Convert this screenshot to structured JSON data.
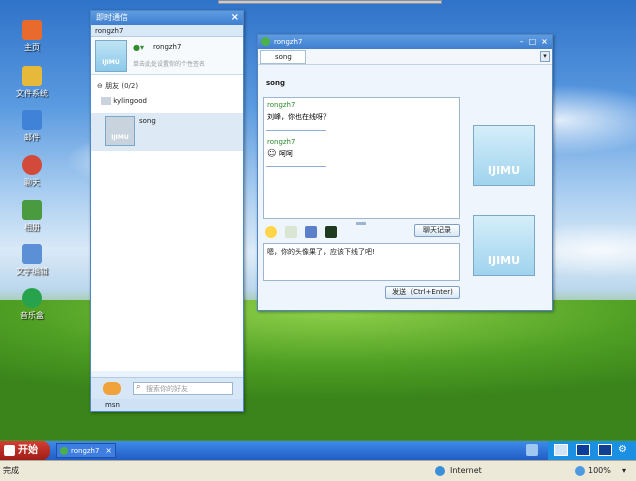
{
  "desktop": {
    "icons": [
      {
        "label": "主页",
        "icon": "home-icon",
        "color": "#e86a2c"
      },
      {
        "label": "文件系统",
        "icon": "folder-icon",
        "color": "#e6b93a"
      },
      {
        "label": "邮件",
        "icon": "mail-icon",
        "color": "#3f82d8"
      },
      {
        "label": "聊天",
        "icon": "chat-icon",
        "color": "#d14a3a"
      },
      {
        "label": "相册",
        "icon": "photo-icon",
        "color": "#4a9a3f"
      },
      {
        "label": "文字编辑",
        "icon": "edit-icon",
        "color": "#5b8fd6"
      },
      {
        "label": "音乐盒",
        "icon": "music-icon",
        "color": "#27a34d"
      }
    ]
  },
  "im_window": {
    "title": "即时通信",
    "account_header": "rongzh7",
    "profile": {
      "name": "rongzh7",
      "signature_placeholder": "单击此处设置你的个性签名",
      "avatar_text": "IJIMU"
    },
    "group": {
      "label": "朋友",
      "count": "(0/2)"
    },
    "friends": [
      {
        "name": "kylingood"
      },
      {
        "name": "song",
        "avatar_text": "IJIMU"
      }
    ],
    "search_placeholder": "搜索你的好友",
    "footer_label": "msn"
  },
  "chat_window": {
    "title": "rongzh7",
    "tab_label": "song",
    "contact_name": "song",
    "messages": [
      {
        "sender": "rongzh7",
        "text": "刘峰，你也在线呀？"
      },
      {
        "sender": "rongzh7",
        "text": "呵呵"
      }
    ],
    "history_button": "聊天记录",
    "input_text": "嗯，你的头像果了，应该下线了吧!",
    "send_button": "发送（Ctrl+Enter)",
    "avatar_text": "IJIMU"
  },
  "taskbar": {
    "start_label": "开始",
    "task_label": "rongzh7"
  },
  "statusbar": {
    "status_text": "完成",
    "zone_text": "Internet",
    "zoom_text": "100%"
  },
  "colors": {
    "title_blue": "#3f7fcf",
    "sender_green": "#2e8b2e",
    "taskbar_blue": "#215dc6",
    "start_red": "#c22f25"
  }
}
